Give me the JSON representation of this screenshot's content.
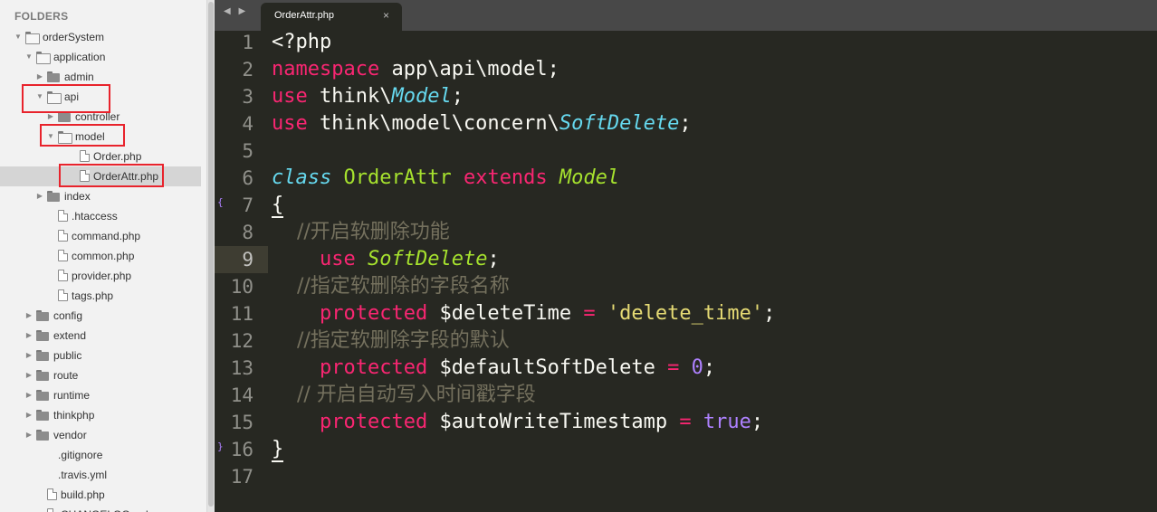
{
  "sidebar": {
    "header": "FOLDERS",
    "items": [
      {
        "label": "orderSystem",
        "type": "folder",
        "open": true,
        "depth": 0
      },
      {
        "label": "application",
        "type": "folder",
        "open": true,
        "depth": 1
      },
      {
        "label": "admin",
        "type": "folder",
        "open": false,
        "depth": 2
      },
      {
        "label": "api",
        "type": "folder",
        "open": true,
        "depth": 2
      },
      {
        "label": "controller",
        "type": "folder",
        "open": false,
        "depth": 3
      },
      {
        "label": "model",
        "type": "folder",
        "open": true,
        "depth": 3
      },
      {
        "label": "Order.php",
        "type": "file",
        "depth": 4
      },
      {
        "label": "OrderAttr.php",
        "type": "file",
        "depth": 4,
        "selected": true
      },
      {
        "label": "index",
        "type": "folder",
        "open": false,
        "depth": 2
      },
      {
        "label": ".htaccess",
        "type": "file",
        "depth": 2
      },
      {
        "label": "command.php",
        "type": "file",
        "depth": 2
      },
      {
        "label": "common.php",
        "type": "file",
        "depth": 2
      },
      {
        "label": "provider.php",
        "type": "file",
        "depth": 2
      },
      {
        "label": "tags.php",
        "type": "file",
        "depth": 2
      },
      {
        "label": "config",
        "type": "folder",
        "open": false,
        "depth": 1
      },
      {
        "label": "extend",
        "type": "folder",
        "open": false,
        "depth": 1
      },
      {
        "label": "public",
        "type": "folder",
        "open": false,
        "depth": 1
      },
      {
        "label": "route",
        "type": "folder",
        "open": false,
        "depth": 1
      },
      {
        "label": "runtime",
        "type": "folder",
        "open": false,
        "depth": 1
      },
      {
        "label": "thinkphp",
        "type": "folder",
        "open": false,
        "depth": 1
      },
      {
        "label": "vendor",
        "type": "folder",
        "open": false,
        "depth": 1
      },
      {
        "label": ".gitignore",
        "type": "file",
        "depth": 1,
        "no_icon": true
      },
      {
        "label": ".travis.yml",
        "type": "file",
        "depth": 1,
        "no_icon": true
      },
      {
        "label": "build.php",
        "type": "file",
        "depth": 1
      },
      {
        "label": "CHANGELOG.md",
        "type": "file",
        "depth": 1
      }
    ],
    "highlight_color": "#e8232c"
  },
  "tabbar": {
    "nav_arrows": "◀ ▶",
    "active_tab": {
      "title": "OrderAttr.php",
      "close": "×"
    }
  },
  "editor": {
    "current_line": 9,
    "colors": {
      "background": "#272822",
      "keyword": "#f92672",
      "storage": "#66d9ef",
      "class_name": "#a6e22e",
      "string": "#e6db74",
      "number": "#ae81ff",
      "comment": "#75715e",
      "plain": "#f8f8f2"
    },
    "lines": [
      {
        "n": "1",
        "tokens": [
          {
            "t": "<?php",
            "c": "plain"
          }
        ]
      },
      {
        "n": "2",
        "tokens": [
          {
            "t": "namespace",
            "c": "keyword"
          },
          {
            "t": " app\\api\\model;",
            "c": "plain"
          }
        ]
      },
      {
        "n": "3",
        "tokens": [
          {
            "t": "use",
            "c": "keyword"
          },
          {
            "t": " think\\",
            "c": "plain"
          },
          {
            "t": "Model",
            "c": "storage",
            "i": true
          },
          {
            "t": ";",
            "c": "plain"
          }
        ]
      },
      {
        "n": "4",
        "tokens": [
          {
            "t": "use",
            "c": "keyword"
          },
          {
            "t": " think\\model\\concern\\",
            "c": "plain"
          },
          {
            "t": "SoftDelete",
            "c": "storage",
            "i": true
          },
          {
            "t": ";",
            "c": "plain"
          }
        ]
      },
      {
        "n": "5",
        "tokens": []
      },
      {
        "n": "6",
        "tokens": [
          {
            "t": "class",
            "c": "storage",
            "i": true
          },
          {
            "t": " ",
            "c": "plain"
          },
          {
            "t": "OrderAttr",
            "c": "class_name"
          },
          {
            "t": " ",
            "c": "plain"
          },
          {
            "t": "extends",
            "c": "keyword"
          },
          {
            "t": " ",
            "c": "plain"
          },
          {
            "t": "Model",
            "c": "class_name",
            "i": true
          }
        ]
      },
      {
        "n": "7",
        "fold": "{",
        "tokens": [
          {
            "t": "{",
            "c": "plain",
            "u": true
          }
        ]
      },
      {
        "n": "8",
        "tokens": [
          {
            "t": "    //开启软删除功能",
            "c": "comment",
            "cjk": true
          }
        ]
      },
      {
        "n": "9",
        "tokens": [
          {
            "t": "    ",
            "c": "plain"
          },
          {
            "t": "use",
            "c": "keyword"
          },
          {
            "t": " ",
            "c": "plain"
          },
          {
            "t": "SoftDelete",
            "c": "class_name",
            "i": true
          },
          {
            "t": ";",
            "c": "plain"
          }
        ]
      },
      {
        "n": "10",
        "tokens": [
          {
            "t": "    //指定软删除的字段名称",
            "c": "comment",
            "cjk": true
          }
        ]
      },
      {
        "n": "11",
        "tokens": [
          {
            "t": "    ",
            "c": "plain"
          },
          {
            "t": "protected",
            "c": "keyword"
          },
          {
            "t": " $deleteTime ",
            "c": "plain"
          },
          {
            "t": "=",
            "c": "keyword"
          },
          {
            "t": " ",
            "c": "plain"
          },
          {
            "t": "'delete_time'",
            "c": "string"
          },
          {
            "t": ";",
            "c": "plain"
          }
        ]
      },
      {
        "n": "12",
        "tokens": [
          {
            "t": "    //指定软删除字段的默认",
            "c": "comment",
            "cjk": true
          }
        ]
      },
      {
        "n": "13",
        "tokens": [
          {
            "t": "    ",
            "c": "plain"
          },
          {
            "t": "protected",
            "c": "keyword"
          },
          {
            "t": " $defaultSoftDelete ",
            "c": "plain"
          },
          {
            "t": "=",
            "c": "keyword"
          },
          {
            "t": " ",
            "c": "plain"
          },
          {
            "t": "0",
            "c": "number"
          },
          {
            "t": ";",
            "c": "plain"
          }
        ]
      },
      {
        "n": "14",
        "tokens": [
          {
            "t": "    // 开启自动写入时间戳字段",
            "c": "comment",
            "cjk": true
          }
        ]
      },
      {
        "n": "15",
        "tokens": [
          {
            "t": "    ",
            "c": "plain"
          },
          {
            "t": "protected",
            "c": "keyword"
          },
          {
            "t": " $autoWriteTimestamp ",
            "c": "plain"
          },
          {
            "t": "=",
            "c": "keyword"
          },
          {
            "t": " ",
            "c": "plain"
          },
          {
            "t": "true",
            "c": "number"
          },
          {
            "t": ";",
            "c": "plain"
          }
        ]
      },
      {
        "n": "16",
        "fold": "}",
        "tokens": [
          {
            "t": "}",
            "c": "plain",
            "u": true
          }
        ]
      },
      {
        "n": "17",
        "tokens": []
      }
    ]
  }
}
